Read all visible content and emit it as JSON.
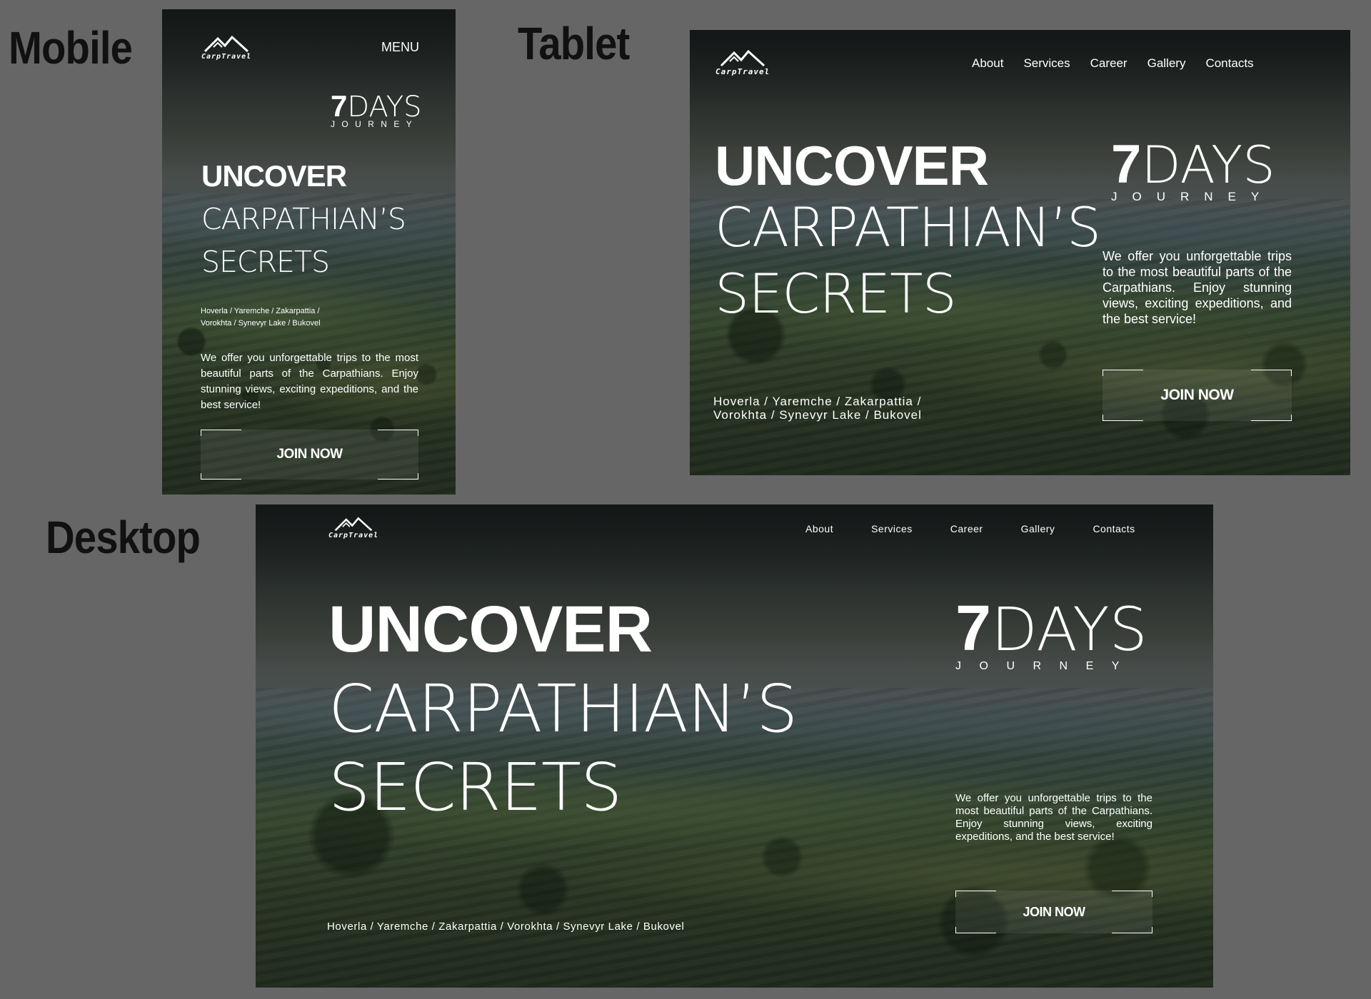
{
  "labels": {
    "mobile": "Mobile",
    "tablet": "Tablet",
    "desktop": "Desktop"
  },
  "brand": {
    "logo_text": "CarpTravel"
  },
  "nav": {
    "menu": "MENU",
    "items": [
      "About",
      "Services",
      "Career",
      "Gallery",
      "Contacts"
    ]
  },
  "hero": {
    "days_number": "7",
    "days_word": "DAYS",
    "journey": "JOURNEY",
    "uncover": "UNCOVER",
    "line2": "CARPATHIAN’S",
    "line3": "SECRETS",
    "places": "Hoverla / Yaremche / Zakarpattia / Vorokhta / Synevyr Lake / Bukovel",
    "places_mobile_1": "Hoverla / Yaremche / Zakarpattia /",
    "places_mobile_2": "Vorokhta / Synevyr Lake / Bukovel",
    "places_tablet_1": "Hoverla / Yaremche / Zakarpattia /",
    "places_tablet_2": "Vorokhta / Synevyr Lake / Bukovel",
    "description": "We offer you unforgettable trips to the most beautiful parts of the Carpathians. Enjoy stunning views, exciting expeditions, and the best service!",
    "cta": "JOIN NOW"
  }
}
